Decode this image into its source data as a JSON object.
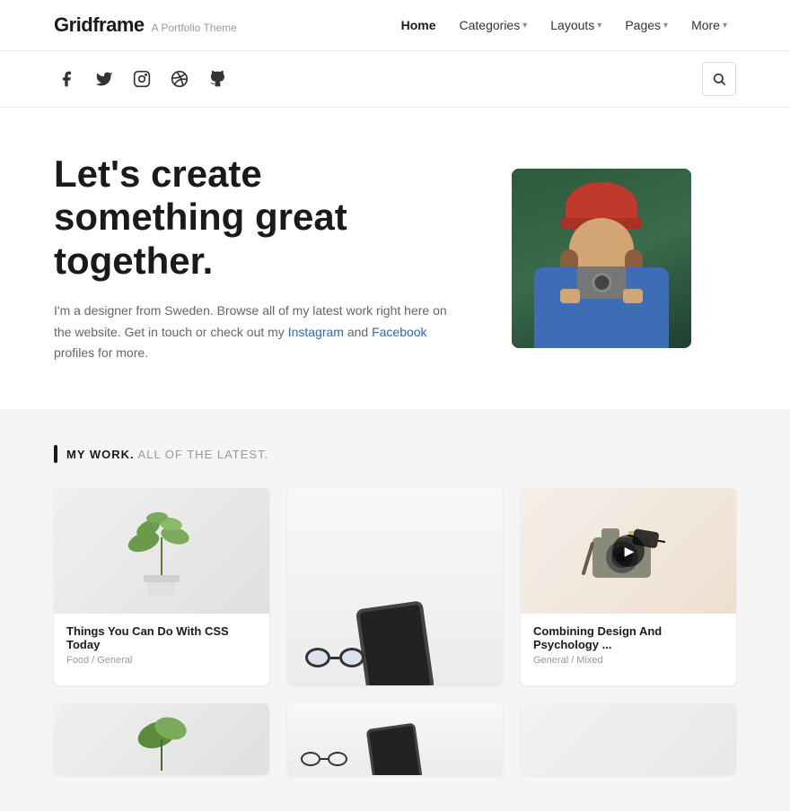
{
  "site": {
    "logo": "Gridframe",
    "tagline": "A Portfolio Theme"
  },
  "nav": {
    "items": [
      {
        "label": "Home",
        "active": true,
        "hasDropdown": false
      },
      {
        "label": "Categories",
        "active": false,
        "hasDropdown": true
      },
      {
        "label": "Layouts",
        "active": false,
        "hasDropdown": true
      },
      {
        "label": "Pages",
        "active": false,
        "hasDropdown": true
      },
      {
        "label": "More",
        "active": false,
        "hasDropdown": true
      }
    ]
  },
  "social": {
    "icons": [
      {
        "name": "facebook",
        "symbol": "f"
      },
      {
        "name": "twitter",
        "symbol": "t"
      },
      {
        "name": "instagram",
        "symbol": "i"
      },
      {
        "name": "dribbble",
        "symbol": "d"
      },
      {
        "name": "github",
        "symbol": "g"
      }
    ]
  },
  "hero": {
    "title": "Let's create something great together.",
    "description_before": "I'm a designer from Sweden. Browse all of my latest work right here on the website. Get in touch or check out my ",
    "link1_text": "Instagram",
    "description_mid": " and ",
    "link2_text": "Facebook",
    "description_after": " profiles for more."
  },
  "work_section": {
    "title_bold": "MY WORK.",
    "title_rest": " ALL OF THE LATEST.",
    "cards": [
      {
        "title": "Things You Can Do With CSS Today",
        "meta": "Food / General",
        "image_type": "plant",
        "has_play": false
      },
      {
        "title": "",
        "meta": "",
        "image_type": "light",
        "has_play": false
      },
      {
        "title": "Combining Design And Psychology ...",
        "meta": "General / Mixed",
        "image_type": "camera",
        "has_play": true
      },
      {
        "title": "",
        "meta": "",
        "image_type": "plant2",
        "has_play": false
      },
      {
        "title": "",
        "meta": "",
        "image_type": "tablet",
        "has_play": false
      },
      {
        "title": "",
        "meta": "",
        "image_type": "last",
        "has_play": false
      }
    ]
  }
}
